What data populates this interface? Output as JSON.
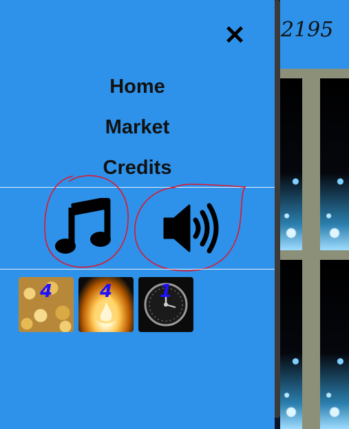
{
  "menu": {
    "close_label": "✕",
    "links": [
      {
        "label": "Home"
      },
      {
        "label": "Market"
      },
      {
        "label": "Credits"
      }
    ]
  },
  "controls": {
    "music_icon": "music-note-icon",
    "sound_icon": "speaker-volume-icon"
  },
  "items": [
    {
      "name": "gold-coins",
      "count": "4"
    },
    {
      "name": "fire",
      "count": "4"
    },
    {
      "name": "clock",
      "count": "1"
    }
  ],
  "hud": {
    "score": "2195"
  },
  "colors": {
    "panel_bg": "#2e92ea",
    "annotation_red": "#e0152a",
    "count_blue": "#1f10ff"
  }
}
